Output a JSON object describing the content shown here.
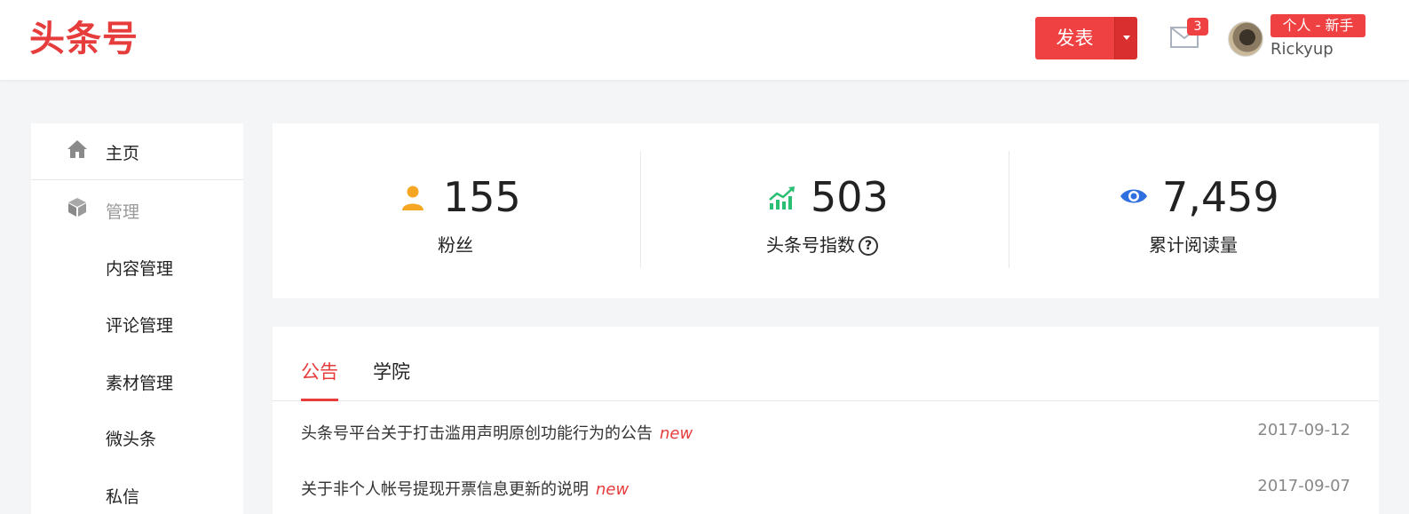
{
  "header": {
    "logo": "头条号",
    "publish_label": "发表",
    "mail_badge": "3",
    "user_tag": "个人 - 新手",
    "username": "Rickyup"
  },
  "sidebar": {
    "home": "主页",
    "manage": "管理",
    "items": [
      "内容管理",
      "评论管理",
      "素材管理",
      "微头条",
      "私信"
    ]
  },
  "stats": [
    {
      "icon": "user-icon",
      "value": "155",
      "label": "粉丝",
      "color": "#f5a623"
    },
    {
      "icon": "trend-up-icon",
      "value": "503",
      "label": "头条号指数",
      "color": "#2bbf73"
    },
    {
      "icon": "eye-icon",
      "value": "7,459",
      "label": "累计阅读量",
      "color": "#2f6fe0"
    }
  ],
  "help_glyph": "?",
  "notice": {
    "tabs": [
      "公告",
      "学院"
    ],
    "active_tab": 0,
    "new_label": "new",
    "rows": [
      {
        "title": "头条号平台关于打击滥用声明原创功能行为的公告",
        "date": "2017-09-12"
      },
      {
        "title": "关于非个人帐号提现开票信息更新的说明",
        "date": "2017-09-07"
      }
    ]
  },
  "colors": {
    "accent": "#e73c3c",
    "background": "#f4f5f6"
  }
}
